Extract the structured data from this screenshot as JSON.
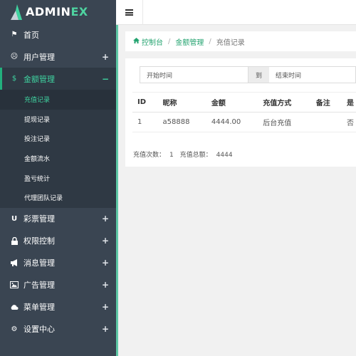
{
  "brand": {
    "name_main": "ADMIN",
    "name_accent": "EX"
  },
  "sidebar": {
    "items": [
      {
        "icon": "flag-icon",
        "glyph": "⚑",
        "label": "首页",
        "toggle": ""
      },
      {
        "icon": "user-circle-icon",
        "glyph": "☹",
        "label": "用户管理",
        "toggle": "+"
      },
      {
        "icon": "dollar-icon",
        "glyph": "$",
        "label": "金额管理",
        "toggle": "−",
        "active": true
      },
      {
        "icon": "magnet-icon",
        "glyph": "∪",
        "label": "彩票管理",
        "toggle": "+"
      },
      {
        "icon": "lock-icon",
        "glyph": "🔒",
        "label": "权限控制",
        "toggle": "+"
      },
      {
        "icon": "bullhorn-icon",
        "glyph": "📢",
        "label": "消息管理",
        "toggle": "+"
      },
      {
        "icon": "image-icon",
        "glyph": "▣",
        "label": "广告管理",
        "toggle": "+"
      },
      {
        "icon": "cloud-icon",
        "glyph": "☁",
        "label": "菜单管理",
        "toggle": "+"
      },
      {
        "icon": "gear-icon",
        "glyph": "⚙",
        "label": "设置中心",
        "toggle": "+"
      }
    ],
    "submenu": [
      "充值记录",
      "提现记录",
      "投注记录",
      "金额流水",
      "盈亏统计",
      "代理团队记录"
    ]
  },
  "breadcrumb": {
    "home": "控制台",
    "section": "金额管理",
    "current": "充值记录",
    "separator": "/"
  },
  "filters": {
    "start_placeholder": "开始时间",
    "range_separator": "到",
    "end_placeholder": "结束时间"
  },
  "table": {
    "headers": [
      "ID",
      "昵称",
      "金额",
      "充值方式",
      "备注",
      "是"
    ],
    "rows": [
      [
        "1",
        "a58888",
        "4444.00",
        "后台充值",
        "",
        "否"
      ]
    ]
  },
  "summary": {
    "count_label": "充值次数：",
    "count": "1",
    "total_label": "充值总额：",
    "total": "4444"
  },
  "colors": {
    "sidebar_bg": "#3a4552",
    "accent": "#22b07d",
    "link": "#23a36f"
  }
}
